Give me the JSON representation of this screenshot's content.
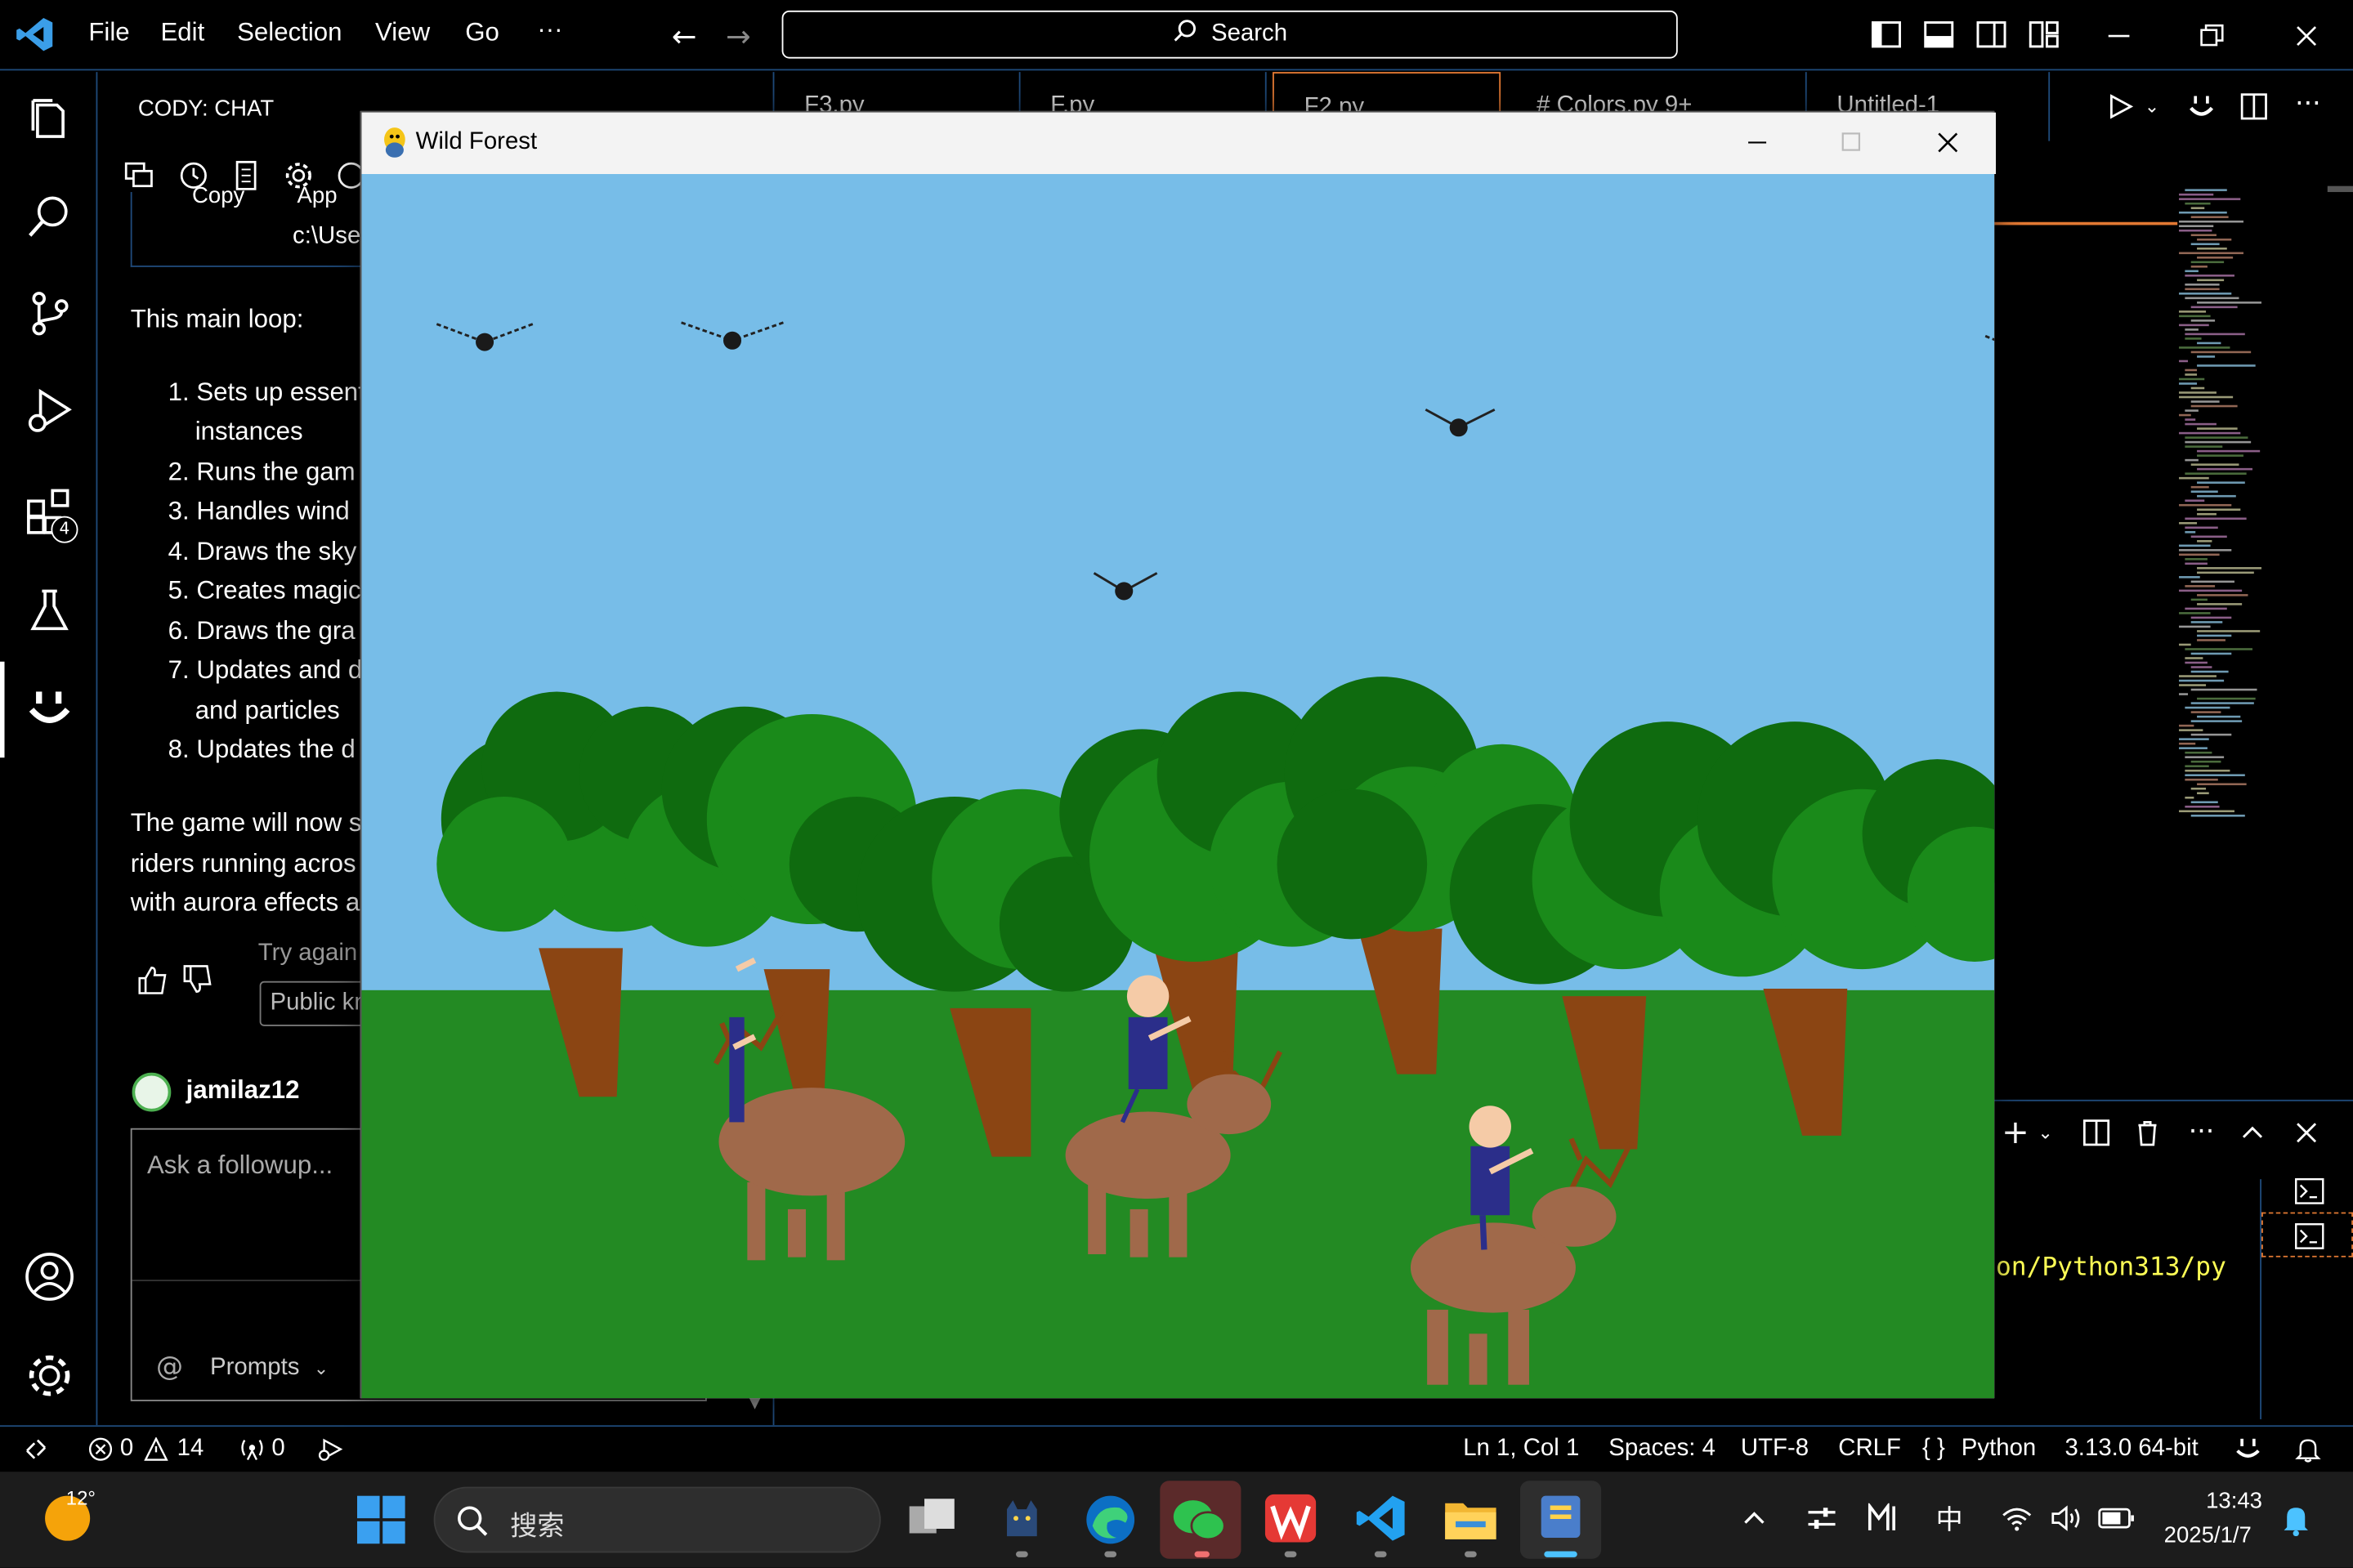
{
  "menu": {
    "items": [
      "File",
      "Edit",
      "Selection",
      "View",
      "Go"
    ],
    "more": "···",
    "search_label": "Search"
  },
  "activity": {
    "extensions_badge": "4"
  },
  "chat": {
    "header": "CODY: CHAT",
    "code_fragment_1": "Copy",
    "code_fragment_2": "App",
    "code_path": "c:\\Use",
    "intro": "This main loop:",
    "list": [
      "1. Sets up essent",
      "instances",
      "2. Runs the gam",
      "3. Handles wind",
      "4. Draws the sky",
      "5. Creates magic",
      "6. Draws the gra",
      "7. Updates and d",
      "and particles",
      "8. Updates the d"
    ],
    "outro": [
      "The game will now s",
      "riders running acros",
      "with aurora effects a"
    ],
    "try_again": "Try again",
    "public_knowledge": "Public kn",
    "username": "jamilaz12",
    "followup_placeholder": "Ask a followup...",
    "prompts_label": "Prompts"
  },
  "tabs": [
    {
      "label": "F3.py"
    },
    {
      "label": "F.py"
    },
    {
      "label": "F2.py"
    },
    {
      "label": "# Colors.py 9+"
    },
    {
      "label": "Untitled-1"
    }
  ],
  "terminal": {
    "path_text": "on/Python313/py"
  },
  "game": {
    "window_title": "Wild Forest",
    "colors": {
      "sky": "#77bde8",
      "grass": "#238a23",
      "foliage_dark": "#0f6b0f",
      "foliage_light": "#1a8a1a",
      "trunk": "#8b4513",
      "horse": "#a0694a",
      "rider_body": "#2b2e8a",
      "skin": "#f5cba7",
      "bird": "#1a1a1a"
    }
  },
  "status": {
    "errors": "0",
    "warnings": "14",
    "ports": "0",
    "position": "Ln 1, Col 1",
    "spaces": "Spaces: 4",
    "encoding": "UTF-8",
    "eol": "CRLF",
    "language": "Python",
    "interpreter": "3.13.0 64-bit"
  },
  "taskbar": {
    "weather": "12°",
    "search_label": "搜索",
    "ime": "中",
    "time": "13:43",
    "date": "2025/1/7"
  }
}
